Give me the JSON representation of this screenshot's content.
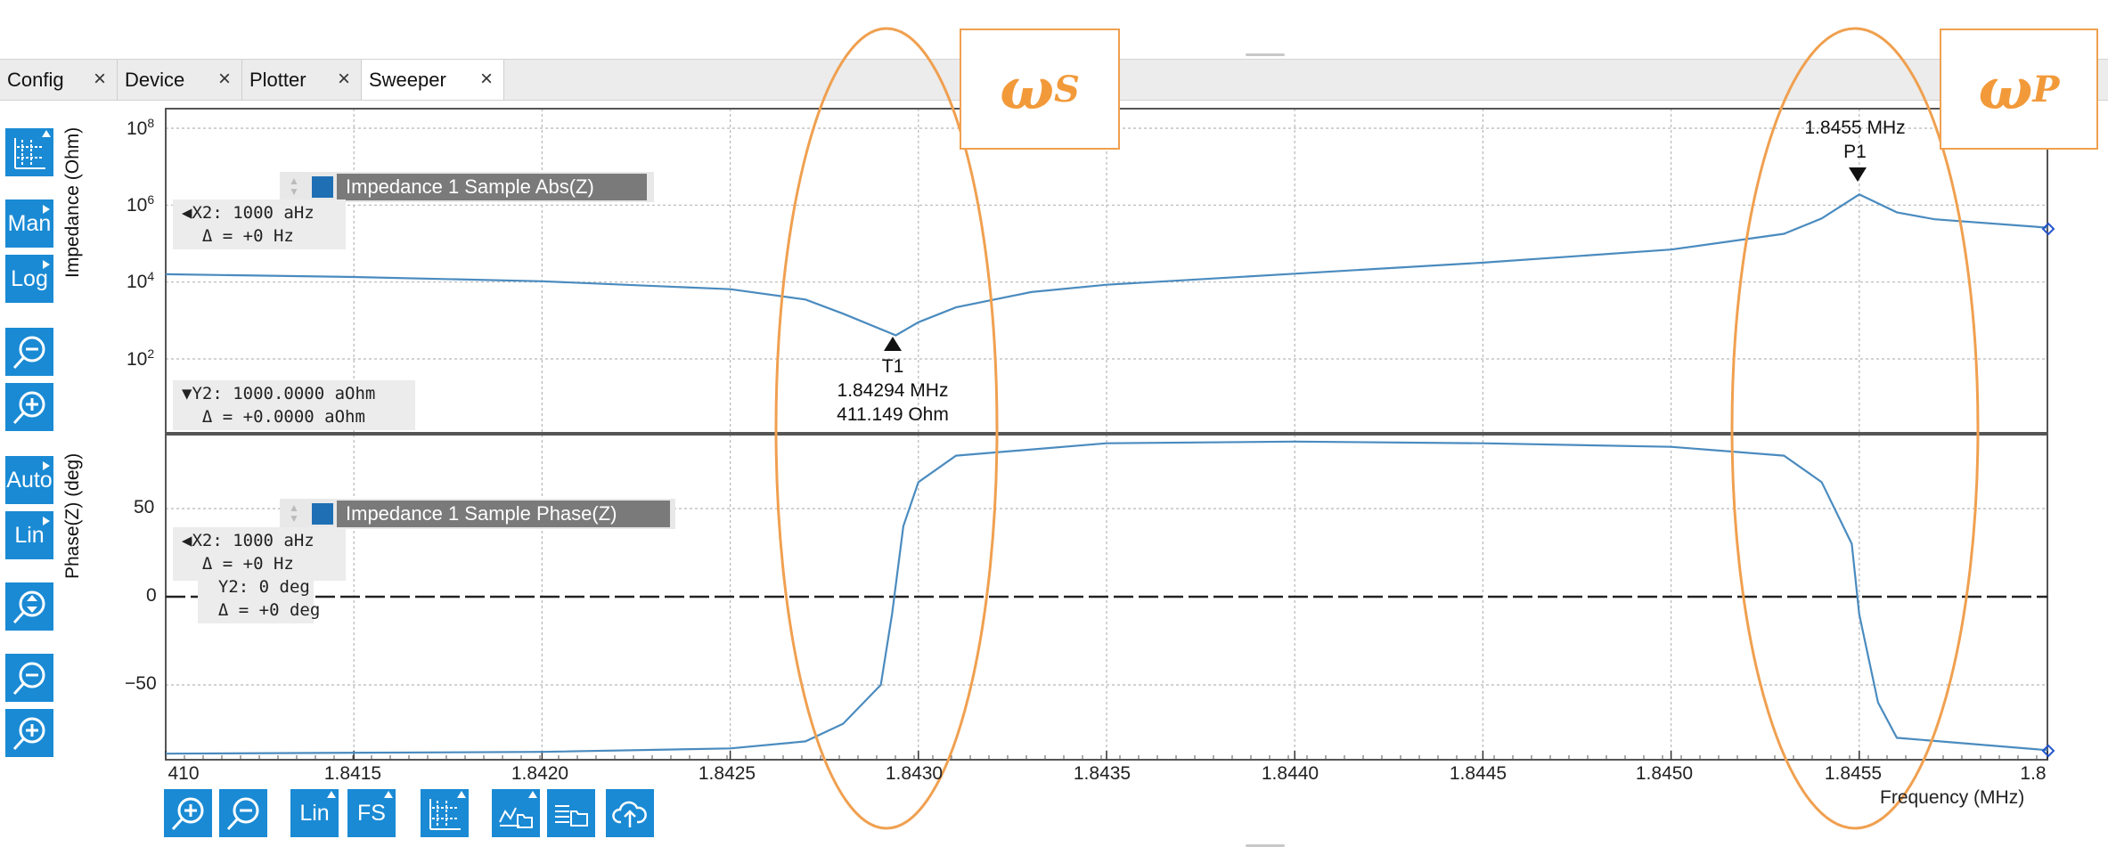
{
  "tabs": [
    {
      "label": "Config"
    },
    {
      "label": "Device"
    },
    {
      "label": "Plotter"
    },
    {
      "label": "Sweeper"
    }
  ],
  "active_tab": "Sweeper",
  "tab_close_glyph": "×",
  "toolbar_left": {
    "grid_icon": "grid-icon",
    "man_label": "Man",
    "log_label": "Log",
    "auto_label": "Auto",
    "lin_label": "Lin"
  },
  "toolbar_bottom": {
    "lin_label": "Lin",
    "fs_label": "FS"
  },
  "top_plot": {
    "ylabel": "Impedance (Ohm)",
    "yticks": [
      {
        "base": "10",
        "exp": "8"
      },
      {
        "base": "10",
        "exp": "6"
      },
      {
        "base": "10",
        "exp": "4"
      },
      {
        "base": "10",
        "exp": "2"
      }
    ],
    "legend": "Impedance 1 Sample Abs(Z)",
    "cursor_x": {
      "line1": "◀X2: 1000 aHz",
      "line2": "  Δ = +0 Hz"
    },
    "cursor_y": {
      "line1": "▼Y2: 1000.0000 aOhm",
      "line2": "  Δ = +0.0000 aOhm"
    },
    "marker_t1": {
      "name": "T1",
      "freq": "1.84294 MHz",
      "value": "411.149 Ohm"
    },
    "marker_p1": {
      "name": "P1",
      "freq": "1.8455 MHz"
    }
  },
  "bottom_plot": {
    "ylabel": "Phase(Z) (deg)",
    "yticks": [
      "50",
      "0",
      "−50"
    ],
    "legend": "Impedance 1 Sample Phase(Z)",
    "cursor_x": {
      "line1": "◀X2: 1000 aHz",
      "line2": "  Δ = +0 Hz"
    },
    "cursor_y": {
      "line1": "  Y2: 0 deg",
      "line2": "  Δ = +0 deg"
    }
  },
  "x_axis": {
    "label": "Frequency (MHz)",
    "ticks": [
      "1.8415",
      "1.8420",
      "1.8425",
      "1.8430",
      "1.8435",
      "1.8440",
      "1.8445",
      "1.8450",
      "1.8455"
    ],
    "left_partial": "410",
    "right_partial": "1.8"
  },
  "annotations": {
    "series": "ω",
    "series_sub": "S",
    "parallel": "ω",
    "parallel_sub": "P"
  },
  "colors": {
    "trace": "#4a8bbf",
    "annotation": "#f29a3a",
    "toolbar_button": "#1a8ad4"
  },
  "chart_data": [
    {
      "type": "line",
      "title": "",
      "xlabel": "Frequency (MHz)",
      "ylabel": "Impedance (Ohm)",
      "yscale": "log",
      "xlim": [
        1.841,
        1.846
      ],
      "ylim": [
        1,
        100000000
      ],
      "grid": true,
      "series": [
        {
          "name": "Impedance 1 Sample Abs(Z)",
          "x": [
            1.841,
            1.8415,
            1.842,
            1.8425,
            1.8427,
            1.8428,
            1.84294,
            1.843,
            1.8431,
            1.8433,
            1.8435,
            1.844,
            1.8445,
            1.845,
            1.8453,
            1.8454,
            1.8455,
            1.8456,
            1.8457,
            1.846
          ],
          "y": [
            16000,
            13500,
            10500,
            6500,
            3500,
            1500,
            411,
            900,
            2200,
            5500,
            8500,
            16500,
            32000,
            70000,
            180000,
            450000,
            1900000,
            650000,
            430000,
            260000
          ]
        }
      ]
    },
    {
      "type": "line",
      "title": "",
      "xlabel": "Frequency (MHz)",
      "ylabel": "Phase(Z) (deg)",
      "xlim": [
        1.841,
        1.846
      ],
      "ylim": [
        -90,
        90
      ],
      "grid": true,
      "series": [
        {
          "name": "Impedance 1 Sample Phase(Z)",
          "x": [
            1.841,
            1.842,
            1.8425,
            1.8427,
            1.8428,
            1.8429,
            1.84293,
            1.84296,
            1.843,
            1.8431,
            1.8435,
            1.844,
            1.8445,
            1.845,
            1.8453,
            1.8454,
            1.84548,
            1.8455,
            1.84555,
            1.8456,
            1.846
          ],
          "y": [
            -89,
            -88,
            -86,
            -82,
            -72,
            -50,
            -10,
            40,
            65,
            80,
            87,
            88,
            87,
            85,
            80,
            65,
            30,
            -10,
            -60,
            -80,
            -87
          ]
        }
      ]
    }
  ]
}
